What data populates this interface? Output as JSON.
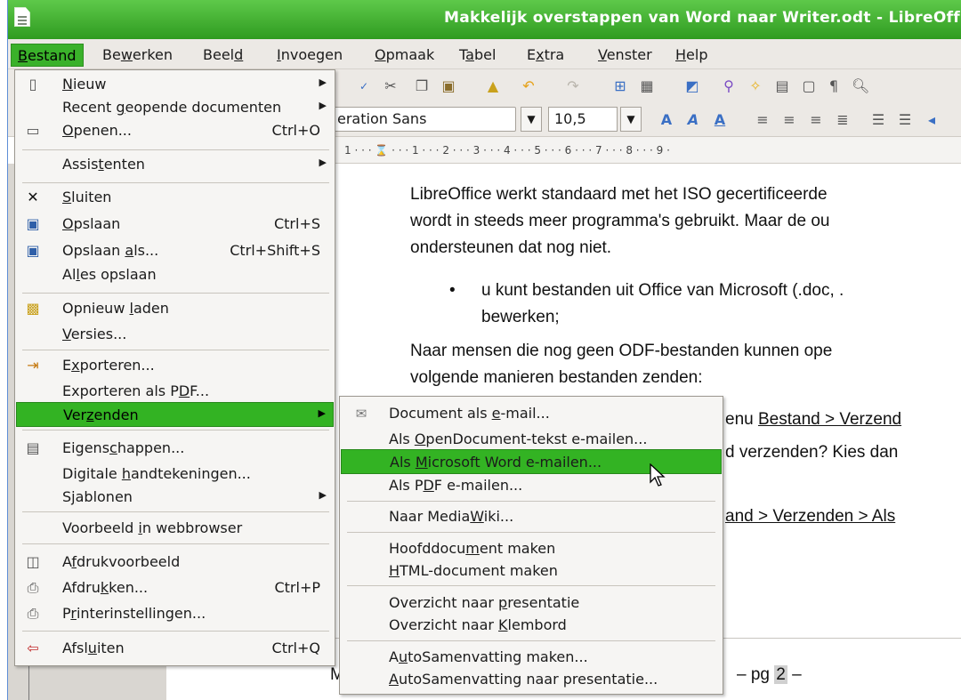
{
  "window": {
    "title": "Makkelijk overstappen van Word naar Writer.odt - LibreOffic"
  },
  "menubar": {
    "items": [
      {
        "pre": "",
        "key": "B",
        "post": "estand"
      },
      {
        "pre": "Be",
        "key": "w",
        "post": "erken"
      },
      {
        "pre": "Beel",
        "key": "d",
        "post": ""
      },
      {
        "pre": "",
        "key": "I",
        "post": "nvoegen"
      },
      {
        "pre": "",
        "key": "O",
        "post": "pmaak"
      },
      {
        "pre": "T",
        "key": "a",
        "post": "bel"
      },
      {
        "pre": "E",
        "key": "x",
        "post": "tra"
      },
      {
        "pre": "",
        "key": "V",
        "post": "enster"
      },
      {
        "pre": "",
        "key": "H",
        "post": "elp"
      }
    ]
  },
  "toolbar": {
    "font_name": "eration Sans",
    "font_size": "10,5"
  },
  "ruler": {
    "ticks": "1 · · · ⌛ · · · 1 · · · 2 · · · 3 · · · 4 · · · 5 · · · 6 · · · 7 · · · 8 · · · 9 ·"
  },
  "file_menu": {
    "items": [
      {
        "pre": "",
        "key": "N",
        "post": "ieuw",
        "shortcut": "",
        "submenu": true,
        "icon": "new-document-icon"
      },
      {
        "pre": "Recent ",
        "key": "g",
        "post": "eopende documenten",
        "shortcut": "",
        "submenu": true,
        "icon": ""
      },
      {
        "pre": "",
        "key": "O",
        "post": "penen...",
        "shortcut": "Ctrl+O",
        "submenu": false,
        "icon": "open-folder-icon"
      },
      {
        "pre": "Assis",
        "key": "t",
        "post": "enten",
        "shortcut": "",
        "submenu": true,
        "icon": ""
      },
      {
        "pre": "",
        "key": "S",
        "post": "luiten",
        "shortcut": "",
        "submenu": false,
        "icon": "close-icon"
      },
      {
        "pre": "",
        "key": "O",
        "post": "pslaan",
        "shortcut": "Ctrl+S",
        "submenu": false,
        "icon": "save-icon"
      },
      {
        "pre": "Opslaan ",
        "key": "a",
        "post": "ls...",
        "shortcut": "Ctrl+Shift+S",
        "submenu": false,
        "icon": "save-as-icon"
      },
      {
        "pre": "Al",
        "key": "l",
        "post": "es opslaan",
        "shortcut": "",
        "submenu": false,
        "icon": ""
      },
      {
        "pre": "Opnieuw ",
        "key": "l",
        "post": "aden",
        "shortcut": "",
        "submenu": false,
        "icon": "reload-icon"
      },
      {
        "pre": "",
        "key": "V",
        "post": "ersies...",
        "shortcut": "",
        "submenu": false,
        "icon": ""
      },
      {
        "pre": "E",
        "key": "x",
        "post": "porteren...",
        "shortcut": "",
        "submenu": false,
        "icon": "export-icon"
      },
      {
        "pre": "Exporteren als P",
        "key": "D",
        "post": "F...",
        "shortcut": "",
        "submenu": false,
        "icon": ""
      },
      {
        "pre": "Ver",
        "key": "z",
        "post": "enden",
        "shortcut": "",
        "submenu": true,
        "icon": ""
      },
      {
        "pre": "Eigens",
        "key": "c",
        "post": "happen...",
        "shortcut": "",
        "submenu": false,
        "icon": "properties-icon"
      },
      {
        "pre": "Digitale ",
        "key": "h",
        "post": "andtekeningen...",
        "shortcut": "",
        "submenu": false,
        "icon": ""
      },
      {
        "pre": "S",
        "key": "j",
        "post": "ablonen",
        "shortcut": "",
        "submenu": true,
        "icon": ""
      },
      {
        "pre": "Voorbeeld ",
        "key": "i",
        "post": "n webbrowser",
        "shortcut": "",
        "submenu": false,
        "icon": ""
      },
      {
        "pre": "A",
        "key": "f",
        "post": "drukvoorbeeld",
        "shortcut": "",
        "submenu": false,
        "icon": "print-preview-icon"
      },
      {
        "pre": "Afdru",
        "key": "k",
        "post": "ken...",
        "shortcut": "Ctrl+P",
        "submenu": false,
        "icon": "printer-icon"
      },
      {
        "pre": "P",
        "key": "r",
        "post": "interinstellingen...",
        "shortcut": "",
        "submenu": false,
        "icon": "printer-settings-icon"
      },
      {
        "pre": "Afsl",
        "key": "u",
        "post": "iten",
        "shortcut": "Ctrl+Q",
        "submenu": false,
        "icon": "exit-icon"
      }
    ]
  },
  "send_submenu": {
    "items": [
      {
        "pre": "Document als ",
        "key": "e",
        "post": "-mail...",
        "icon": "email-icon"
      },
      {
        "pre": "Als ",
        "key": "O",
        "post": "penDocument-tekst e-mailen...",
        "icon": ""
      },
      {
        "pre": "Als ",
        "key": "M",
        "post": "icrosoft Word e-mailen...",
        "icon": ""
      },
      {
        "pre": "Als P",
        "key": "D",
        "post": "F e-mailen...",
        "icon": ""
      },
      {
        "pre": "Naar Media",
        "key": "W",
        "post": "iki...",
        "icon": ""
      },
      {
        "pre": "Hoofddocu",
        "key": "m",
        "post": "ent maken",
        "icon": ""
      },
      {
        "pre": "",
        "key": "H",
        "post": "TML-document maken",
        "icon": ""
      },
      {
        "pre": "Overzicht naar ",
        "key": "p",
        "post": "resentatie",
        "icon": ""
      },
      {
        "pre": "Overzicht naar ",
        "key": "K",
        "post": "lembord",
        "icon": ""
      },
      {
        "pre": "A",
        "key": "u",
        "post": "toSamenvatting maken...",
        "icon": ""
      },
      {
        "pre": "",
        "key": "A",
        "post": "utoSamenvatting naar presentatie...",
        "icon": ""
      }
    ]
  },
  "document": {
    "lines": [
      "LibreOffice werkt standaard met het ISO gecertificeerde",
      "wordt in steeds meer programma's gebruikt. Maar de ou",
      "ondersteunen dat nog niet.",
      "u kunt bestanden uit Office van Microsoft (.doc, .",
      "bewerken;",
      "Naar mensen die nog geen ODF-bestanden kunnen ope",
      "volgende manieren bestanden zenden:",
      "enu ",
      "Bestand > Verzend",
      "d verzenden? Kies dan ",
      "and > Verzenden > Als",
      "M",
      "– pg ",
      "2",
      " –"
    ]
  }
}
